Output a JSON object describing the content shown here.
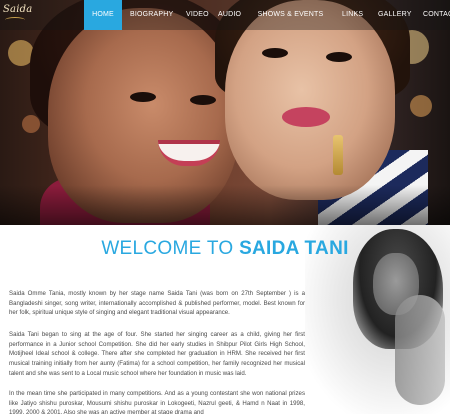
{
  "logo": {
    "text": "Saida"
  },
  "nav": {
    "items": [
      {
        "label": "HOME",
        "active": true
      },
      {
        "label": "BIOGRAPHY",
        "active": false
      },
      {
        "label": "VIDEO",
        "active": false
      },
      {
        "label": "AUDIO",
        "active": false
      },
      {
        "label": "SHOWS & EVENTS",
        "active": false
      },
      {
        "label": "LINKS",
        "active": false
      },
      {
        "label": "GALLERY",
        "active": false
      },
      {
        "label": "CONTAC",
        "active": false
      }
    ],
    "active_color": "#29a8e0"
  },
  "welcome": {
    "prefix": "WELCOME TO ",
    "name": "SAIDA TANI",
    "color": "#29a8e0"
  },
  "paragraphs": [
    "Saida Omme Tania, mostly known by her stage name Saida Tani (was born on 27th September ) is a Bangladeshi singer, song writer, internationally accomplished & published performer, model. Best known for her folk, spiritual unique style of singing and elegant traditional visual appearance.",
    "Saida Tani began to sing at the age of four. She started her singing career as a child, giving her first performance in a Junior school Competition. She did her early studies in Shibpur Pilot Girls High School, Motijheel Ideal school & college. There after she completed her graduation in HRM. She received her first musical training initially from her aunty (Fatima) for a school competition, her family recognized her musical talent and she was sent to a Local music school where her foundation in music was laid.",
    "In the mean time she participated in many competitions. And as a young contestant she won national prizes like Jatiyo shishu puroskar, Mousumi shishu puroskar in Lokogeeti, Nazrul geeti, & Hamd n Naat in 1998, 1999, 2000 & 2001. Also she was an active member at stage drama and"
  ]
}
